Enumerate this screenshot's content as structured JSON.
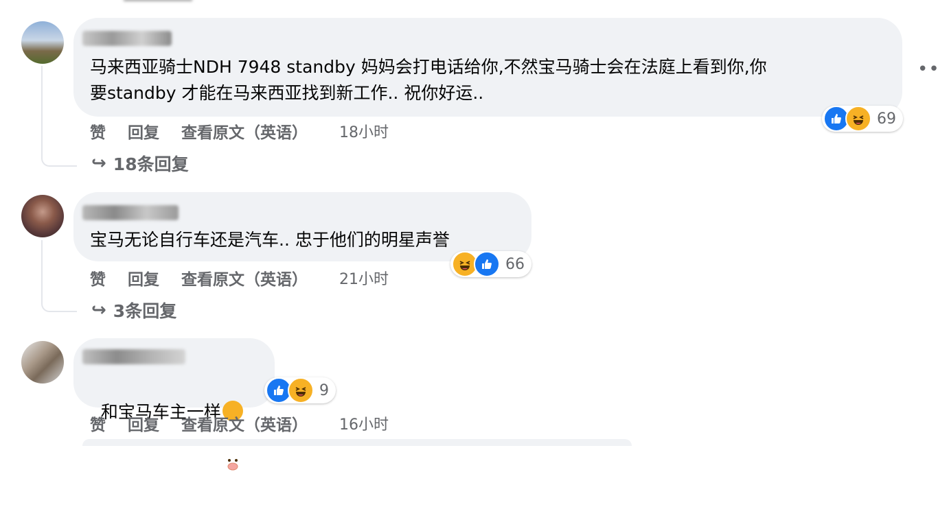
{
  "comments": [
    {
      "text": "马来西亚骑士NDH 7948 standby 妈妈会打电话给你,不然宝马骑士会在法庭上看到你,你\n要standby 才能在马来西亚找到新工作.. 祝你好运..",
      "like": "赞",
      "reply": "回复",
      "see_original": "查看原文（英语）",
      "time": "18小时",
      "reaction_count": "69",
      "replies_label": "18条回复"
    },
    {
      "text": "宝马无论自行车还是汽车.. 忠于他们的明星声誉",
      "like": "赞",
      "reply": "回复",
      "see_original": "查看原文（英语）",
      "time": "21小时",
      "reaction_count": "66",
      "replies_label": "3条回复"
    },
    {
      "text": "和宝马车主一样",
      "like": "赞",
      "reply": "回复",
      "see_original": "查看原文（英语）",
      "time": "16小时",
      "reaction_count": "9"
    }
  ],
  "more_options": "•••",
  "reply_arrow": "↪"
}
